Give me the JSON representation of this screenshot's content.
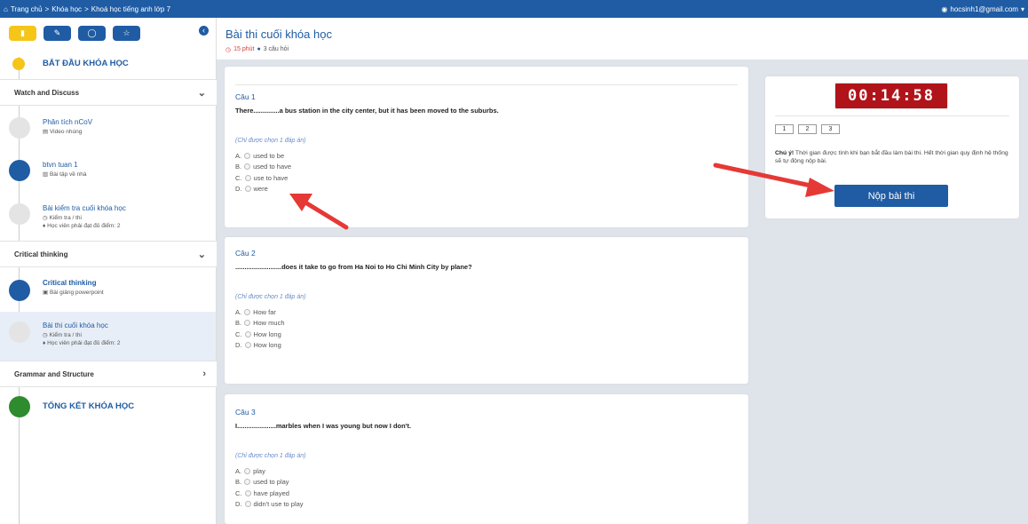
{
  "topbar": {
    "breadcrumb": [
      "Trang chủ",
      "Khóa học",
      "Khoá học tiếng anh lớp 7"
    ],
    "separator": ">",
    "user_email": "hocsinh1@gmail.com"
  },
  "sidebar": {
    "tabs": [
      {
        "icon": "book-icon"
      },
      {
        "icon": "paperclip-icon"
      },
      {
        "icon": "comment-icon"
      },
      {
        "icon": "star-icon"
      }
    ],
    "start_label": "BẮT ĐẦU KHÓA HỌC",
    "end_label": "TỔNG KẾT KHÓA HỌC",
    "sections": [
      {
        "title": "Watch and Discuss",
        "chevron": "⌄"
      },
      {
        "title": "Critical thinking",
        "chevron": "⌄"
      },
      {
        "title": "Grammar and Structure",
        "chevron": "›"
      }
    ],
    "items": [
      {
        "title": "Phân tích nCoV",
        "type": "Video nhúng",
        "type_icon": "▤"
      },
      {
        "title": "btvn tuan 1",
        "type": "Bài tập về nhà",
        "type_icon": "▥"
      },
      {
        "title": "Bài kiểm tra cuối khóa học",
        "type": "Kiểm tra / thi",
        "type_icon": "◷",
        "note": "Học viên phải đạt đủ điểm: 2"
      },
      {
        "title": "Critical thinking",
        "type": "Bài giảng powerpoint",
        "type_icon": "▣"
      },
      {
        "title": "Bài thi cuối khóa học",
        "type": "Kiểm tra / thi",
        "type_icon": "◷",
        "note": "Học viên phải đạt đủ điểm: 2"
      }
    ],
    "colors": {
      "yellow": "#f5c518",
      "blue": "#1f5ca4",
      "grey": "#e4e4e4",
      "green": "#2e8b2e"
    }
  },
  "header": {
    "title": "Bài thi cuối khóa học",
    "duration": "15 phút",
    "questions": "3 câu hỏi"
  },
  "hint_text": "(Chỉ được chọn 1 đáp án)",
  "questions": [
    {
      "label": "Câu 1",
      "text": "There..............a bus station in the city center, but it has been moved to the suburbs.",
      "options": [
        {
          "key": "A.",
          "text": "used to be"
        },
        {
          "key": "B.",
          "text": "used to have"
        },
        {
          "key": "C.",
          "text": "use to have"
        },
        {
          "key": "D.",
          "text": "were"
        }
      ]
    },
    {
      "label": "Câu 2",
      "text": ".........................does it take to go from Ha Noi to Ho Chi Minh City by plane?",
      "options": [
        {
          "key": "A.",
          "text": "How far"
        },
        {
          "key": "B.",
          "text": "How much"
        },
        {
          "key": "C.",
          "text": "How long"
        },
        {
          "key": "D.",
          "text": "How long"
        }
      ]
    },
    {
      "label": "Câu 3",
      "text": "I.....................marbles when I was young but now I don't.",
      "options": [
        {
          "key": "A.",
          "text": "play"
        },
        {
          "key": "B.",
          "text": "used to play"
        },
        {
          "key": "C.",
          "text": "have played"
        },
        {
          "key": "D.",
          "text": "didn't use to play"
        }
      ]
    }
  ],
  "panel": {
    "timer": "00:14:58",
    "nav_buttons": [
      "1",
      "2",
      "3"
    ],
    "note_bold": "Chú ý!",
    "note_text": "Thời gian được tính khi bạn bắt đầu làm bài thi. Hết thời gian quy định hệ thống sẽ tự động nộp bài.",
    "submit_label": "Nộp bài thi"
  },
  "annotation_color": "#e53935"
}
